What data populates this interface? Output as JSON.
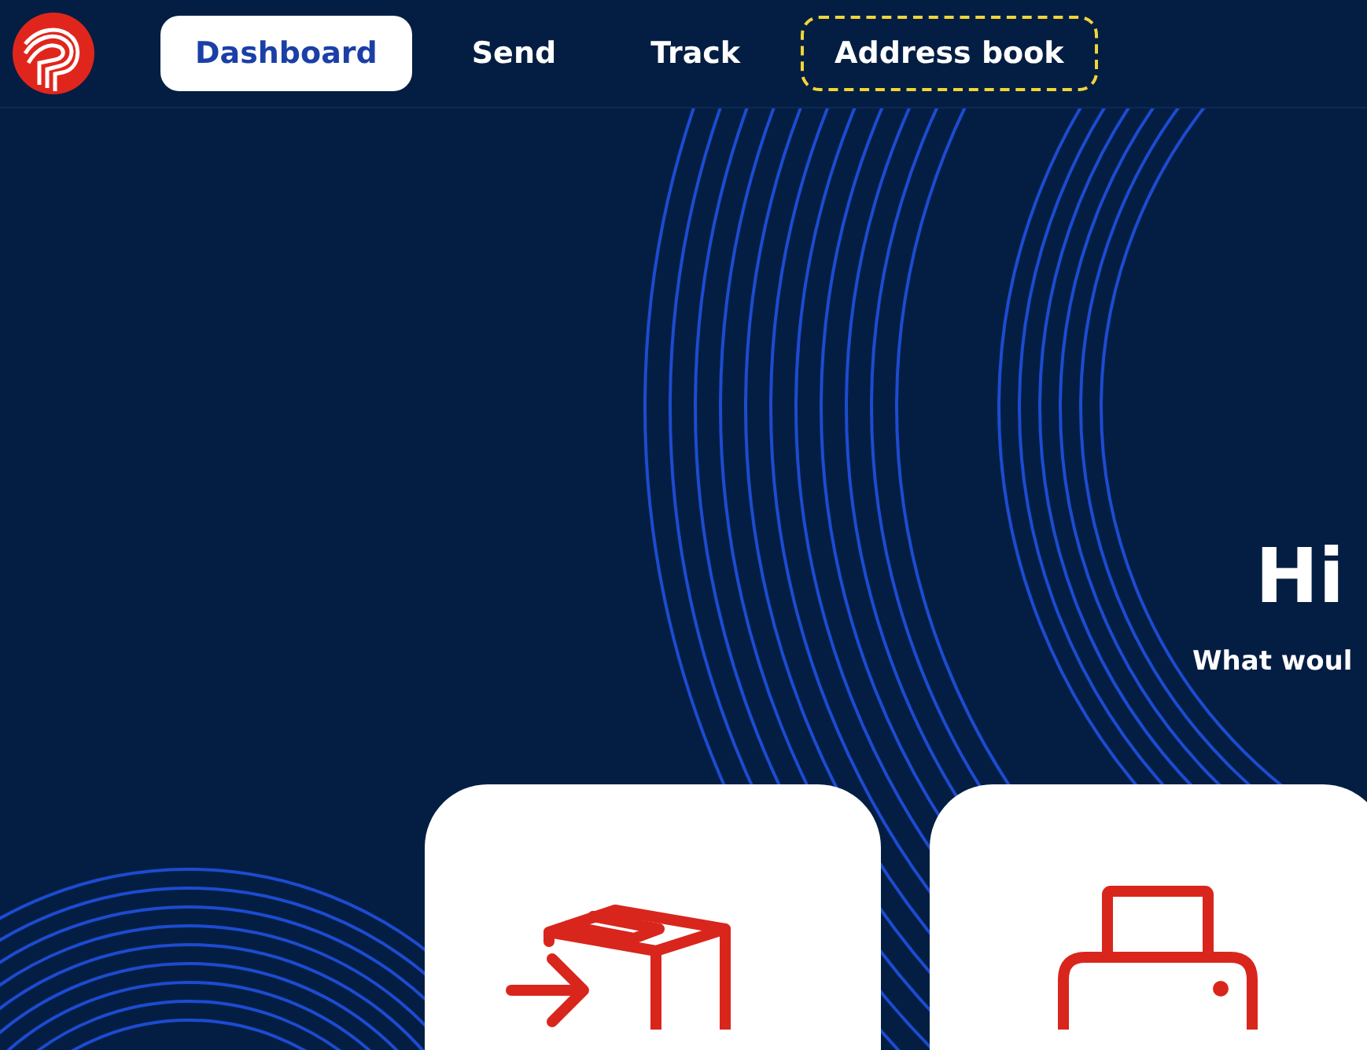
{
  "nav": {
    "items": [
      {
        "label": "Dashboard",
        "selected": true,
        "focused": false
      },
      {
        "label": "Send",
        "selected": false,
        "focused": false
      },
      {
        "label": "Track",
        "selected": false,
        "focused": false
      },
      {
        "label": "Address book",
        "selected": false,
        "focused": true
      }
    ]
  },
  "greeting": {
    "title": "Hi",
    "subtitle": "What woul"
  },
  "cards": [
    {
      "kind": "send-parcel"
    },
    {
      "kind": "print"
    }
  ]
}
